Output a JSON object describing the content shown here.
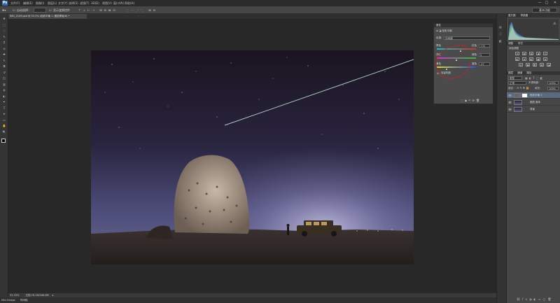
{
  "app": {
    "logo": "Ps",
    "accent": "#2f6fb5"
  },
  "menu": [
    "文件(F)",
    "编辑(E)",
    "图像(I)",
    "图层(L)",
    "文字(Y)",
    "选择(S)",
    "滤镜(T)",
    "3D(D)",
    "视图(V)",
    "窗口(W)",
    "帮助(H)"
  ],
  "window_controls": {
    "minimize": "—",
    "maximize": "□",
    "close": "✕"
  },
  "options": {
    "auto_select_label": "自动选择：",
    "show_transform_label": "显示变换控件",
    "workspace": "基本功能"
  },
  "document_tab": {
    "label": "IMG_2109.psd @ 33.3% (色彩平衡 1, 图层蒙版/8) *"
  },
  "tools": [
    "move-icon",
    "marquee-icon",
    "lasso-icon",
    "quick-select-icon",
    "crop-icon",
    "eyedropper-icon",
    "healing-icon",
    "brush-icon",
    "stamp-icon",
    "history-brush-icon",
    "eraser-icon",
    "gradient-icon",
    "blur-icon",
    "dodge-icon",
    "pen-icon",
    "type-icon",
    "path-select-icon",
    "shape-icon",
    "hand-icon",
    "zoom-icon"
  ],
  "status": {
    "zoom": "33.33%",
    "doc_info": "文档:78.1M/166.6M"
  },
  "minibridge": {
    "label": "Mini Bridge",
    "timeline": "时间轴"
  },
  "properties": {
    "title": "属性",
    "subtitle": "色彩平衡",
    "tone_label": "色调：",
    "tone_value": "中间调",
    "sliders": [
      {
        "left": "青色",
        "right": "红色",
        "value": "+31",
        "pos": 0.62,
        "color_left": "#00c8c8",
        "color_right": "#d03030"
      },
      {
        "left": "洋红",
        "right": "绿色",
        "value": "0",
        "pos": 0.5,
        "color_left": "#d030d0",
        "color_right": "#30c030"
      },
      {
        "left": "黄色",
        "right": "蓝色",
        "value": "-47",
        "pos": 0.26,
        "color_left": "#d8d830",
        "color_right": "#3050d8"
      }
    ],
    "preserve_luminosity": "保留明度",
    "annotation_color": "#d02020"
  },
  "histogram": {
    "tabs": [
      "直方图",
      "导航器"
    ]
  },
  "adjustments": {
    "tab1": "调整",
    "tab2": "样式",
    "add_label": "添加调整"
  },
  "layers_panel": {
    "tabs": [
      "图层",
      "通道",
      "路径"
    ],
    "kind_label": "类型",
    "blend_mode": "正常",
    "opacity_label": "不透明度：",
    "opacity_value": "100%",
    "lock_label": "锁定：",
    "fill_label": "填充：",
    "fill_value": "100%",
    "layers": [
      {
        "name": "色彩平衡 1",
        "selected": true
      },
      {
        "name": "图层 副本",
        "selected": false
      },
      {
        "name": "背景",
        "selected": false
      }
    ]
  }
}
